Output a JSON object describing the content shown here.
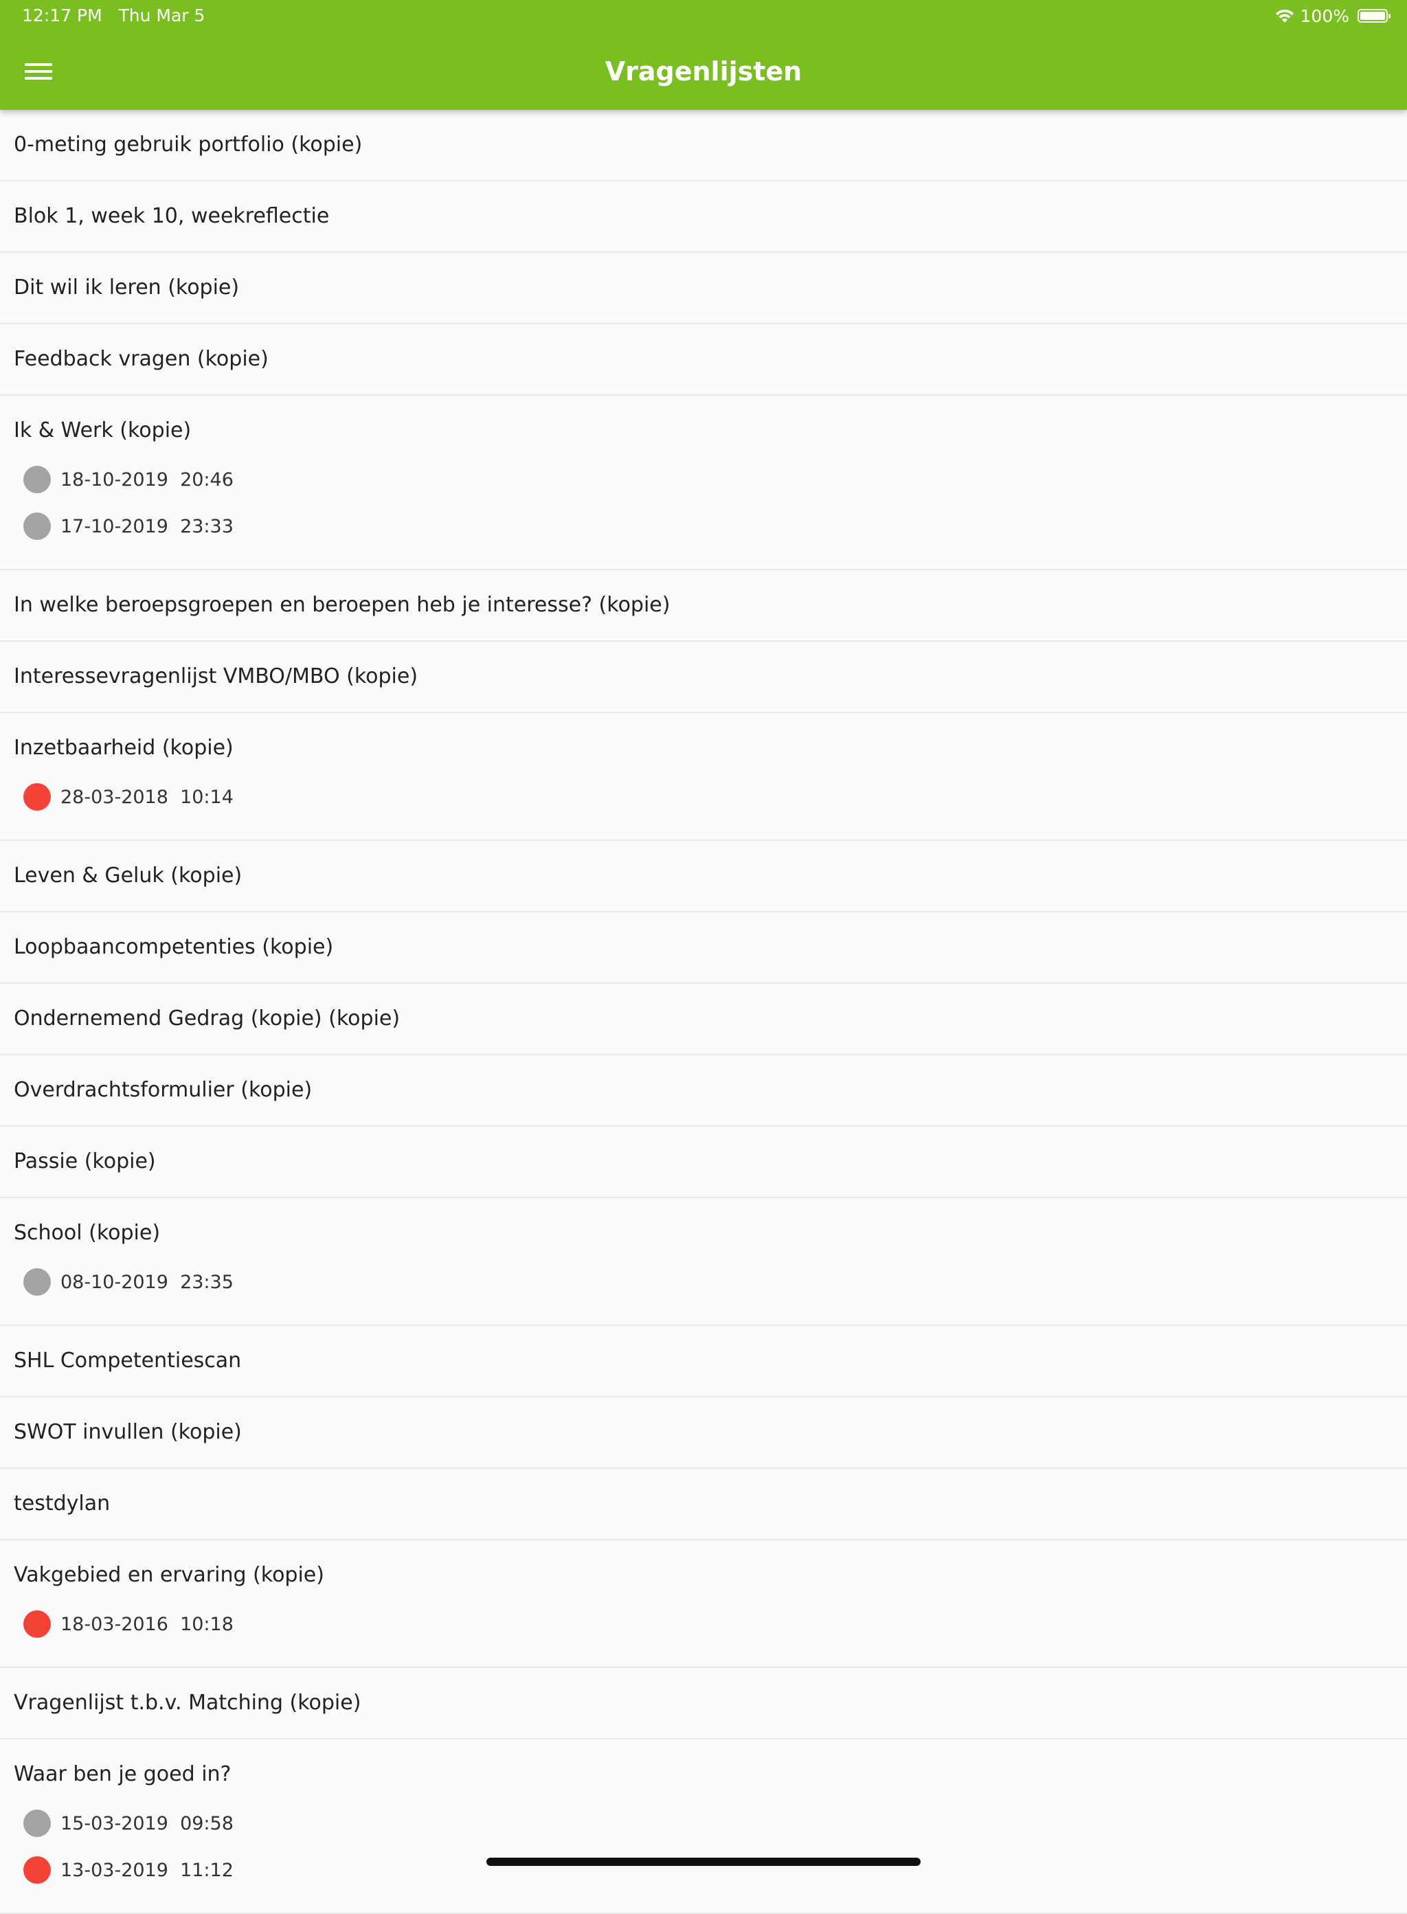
{
  "status_bar": {
    "time": "12:17 PM   Thu Mar 5",
    "battery": "100%",
    "battery_level": 1.0,
    "wifi_icon": "wifi-icon",
    "battery_icon": "battery-icon"
  },
  "header": {
    "title": "Vragenlijsten",
    "menu_icon": "hamburger-menu-icon",
    "background_color": "#7abf22"
  },
  "status_colors": {
    "gray": "#a3a3a3",
    "red": "#f44336"
  },
  "questionnaires": [
    {
      "title": "0-meting gebruik portfolio (kopie)",
      "entries": []
    },
    {
      "title": "Blok 1, week 10, weekreflectie",
      "entries": []
    },
    {
      "title": "Dit wil ik leren (kopie)",
      "entries": []
    },
    {
      "title": "Feedback vragen (kopie)",
      "entries": []
    },
    {
      "title": "Ik & Werk (kopie)",
      "entries": [
        {
          "status": "gray",
          "datetime": "18-10-2019  20:46"
        },
        {
          "status": "gray",
          "datetime": "17-10-2019  23:33"
        }
      ]
    },
    {
      "title": "In welke beroepsgroepen en beroepen heb je interesse? (kopie)",
      "entries": []
    },
    {
      "title": "Interessevragenlijst VMBO/MBO (kopie)",
      "entries": []
    },
    {
      "title": "Inzetbaarheid (kopie)",
      "entries": [
        {
          "status": "red",
          "datetime": "28-03-2018  10:14"
        }
      ]
    },
    {
      "title": "Leven & Geluk (kopie)",
      "entries": []
    },
    {
      "title": "Loopbaancompetenties (kopie)",
      "entries": []
    },
    {
      "title": "Ondernemend Gedrag (kopie) (kopie)",
      "entries": []
    },
    {
      "title": "Overdrachtsformulier (kopie)",
      "entries": []
    },
    {
      "title": "Passie (kopie)",
      "entries": []
    },
    {
      "title": "School (kopie)",
      "entries": [
        {
          "status": "gray",
          "datetime": "08-10-2019  23:35"
        }
      ]
    },
    {
      "title": "SHL Competentiescan",
      "entries": []
    },
    {
      "title": "SWOT invullen (kopie)",
      "entries": []
    },
    {
      "title": "testdylan",
      "entries": []
    },
    {
      "title": "Vakgebied en ervaring (kopie)",
      "entries": [
        {
          "status": "red",
          "datetime": "18-03-2016  10:18"
        }
      ]
    },
    {
      "title": "Vragenlijst t.b.v. Matching (kopie)",
      "entries": []
    },
    {
      "title": "Waar ben je goed in?",
      "entries": [
        {
          "status": "gray",
          "datetime": "15-03-2019  09:58"
        },
        {
          "status": "red",
          "datetime": "13-03-2019  11:12"
        }
      ]
    }
  ]
}
